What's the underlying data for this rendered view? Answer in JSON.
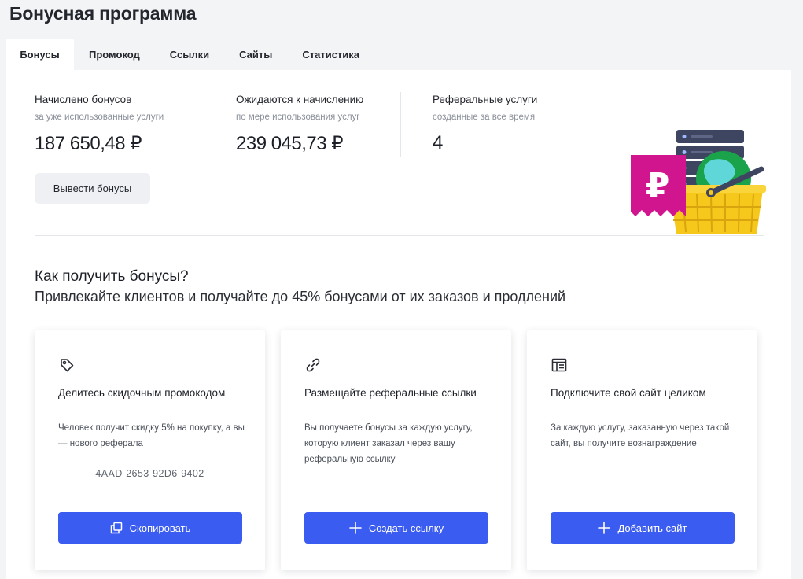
{
  "page": {
    "title": "Бонусная программа"
  },
  "tabs": [
    {
      "label": "Бонусы",
      "active": true
    },
    {
      "label": "Промокод"
    },
    {
      "label": "Ссылки"
    },
    {
      "label": "Сайты"
    },
    {
      "label": "Статистика"
    }
  ],
  "stats": [
    {
      "label": "Начислено бонусов",
      "sub": "за уже использованные услуги",
      "value": "187 650,48 ₽"
    },
    {
      "label": "Ожидаются к начислению",
      "sub": "по мере использования услуг",
      "value": "239 045,73 ₽"
    },
    {
      "label": "Реферальные услуги",
      "sub": "созданные за все время",
      "value": "4"
    }
  ],
  "withdraw_button": "Вывести бонусы",
  "illustration": {
    "icon": "ruble-tag-basket-server-icon",
    "currency_symbol": "₽"
  },
  "how": {
    "title": "Как получить бонусы?",
    "subtitle": "Привлекайте клиентов и получайте до 45% бонусами от их заказов и продлений"
  },
  "cards": [
    {
      "icon": "tag-icon",
      "title": "Делитесь скидочным промокодом",
      "desc": "Человек получит скидку 5% на покупку, а вы — нового реферала",
      "code": "4AAD-2653-92D6-9402",
      "button": "Скопировать",
      "button_icon": "copy-icon"
    },
    {
      "icon": "link-icon",
      "title": "Размещайте реферальные ссылки",
      "desc": "Вы получаете бонусы за каждую услугу, которую клиент заказал через вашу реферальную ссылку",
      "button": "Создать ссылку",
      "button_icon": "plus-icon"
    },
    {
      "icon": "website-icon",
      "title": "Подключите свой сайт целиком",
      "desc": "За каждую услугу, заказанную через такой сайт, вы получите вознаграждение",
      "button": "Добавить сайт",
      "button_icon": "plus-icon"
    }
  ],
  "colors": {
    "accent": "#3b5cf0",
    "background": "#f3f4f6",
    "ruble_tag": "#d1158f",
    "basket": "#f7c81c"
  }
}
